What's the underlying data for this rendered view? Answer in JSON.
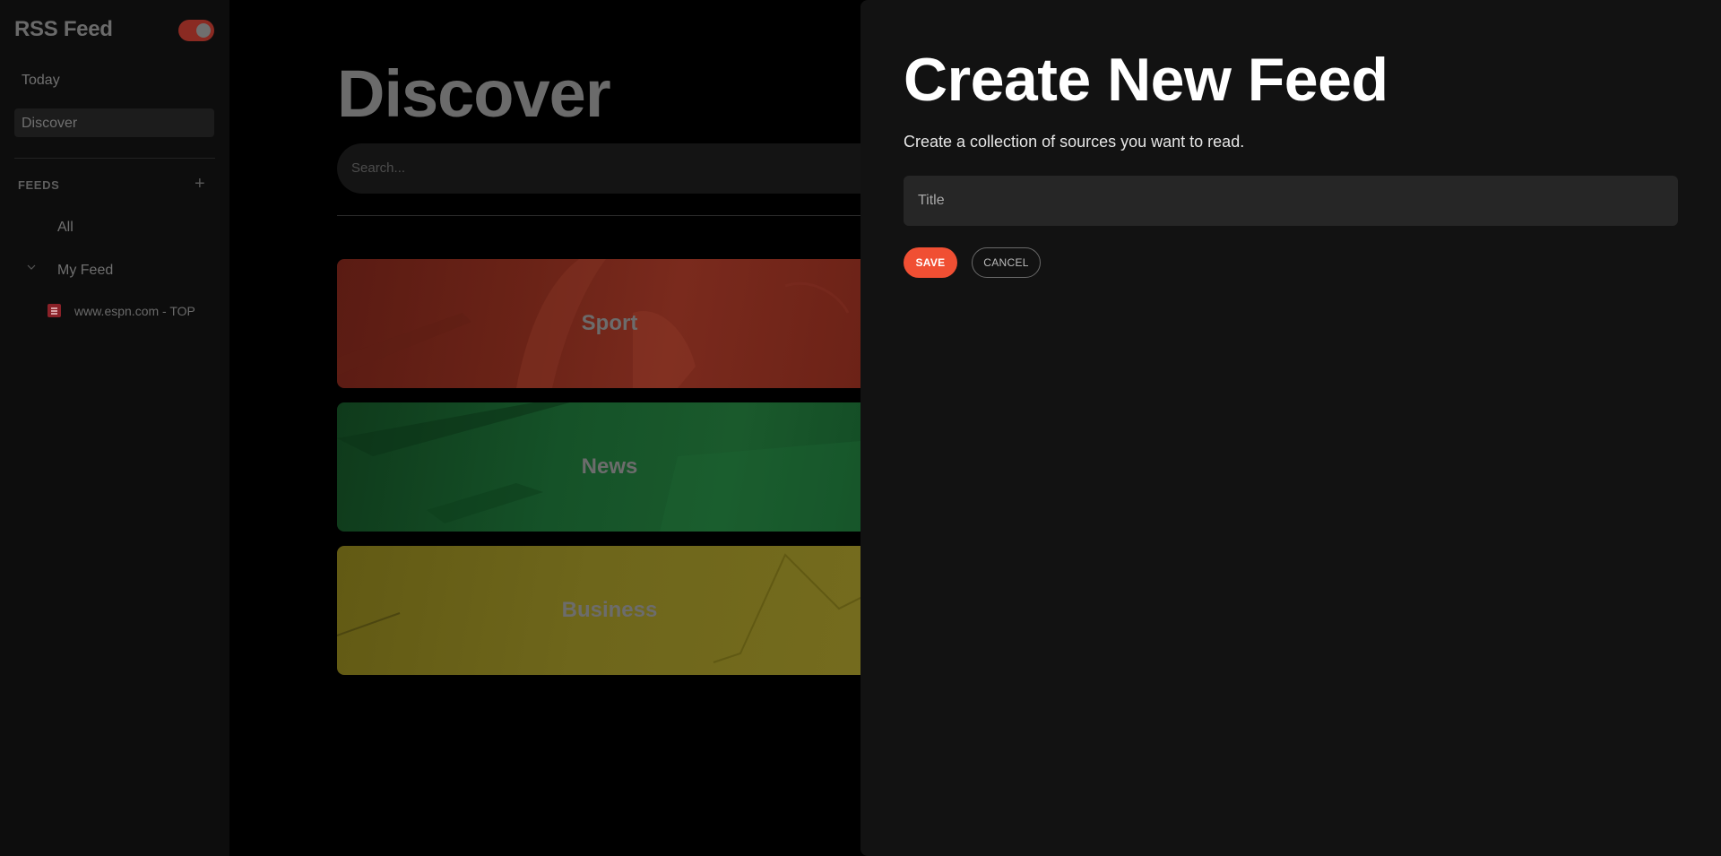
{
  "app": {
    "title": "RSS Feed",
    "theme_toggle_on": true,
    "accent_color": "#f04f33"
  },
  "sidebar": {
    "nav": [
      {
        "label": "Today"
      },
      {
        "label": "Discover",
        "active": true
      }
    ],
    "feeds_header": "FEEDS",
    "add_icon": "plus-icon",
    "feeds": {
      "all_label": "All",
      "group_label": "My Feed",
      "group_expanded": true,
      "sources": [
        {
          "label": "www.espn.com - TOP",
          "icon": "espn-favicon-icon"
        }
      ]
    }
  },
  "main": {
    "title": "Discover",
    "search_placeholder": "Search...",
    "categories": [
      {
        "label": "Sport",
        "color": "#6b2317"
      },
      {
        "label": "News",
        "color": "#155228"
      },
      {
        "label": "Business",
        "color": "#6e661b"
      }
    ]
  },
  "panel": {
    "title": "Create New Feed",
    "subtitle": "Create a collection of sources you want to read.",
    "title_input": {
      "placeholder": "Title",
      "value": ""
    },
    "save_label": "SAVE",
    "cancel_label": "CANCEL"
  }
}
